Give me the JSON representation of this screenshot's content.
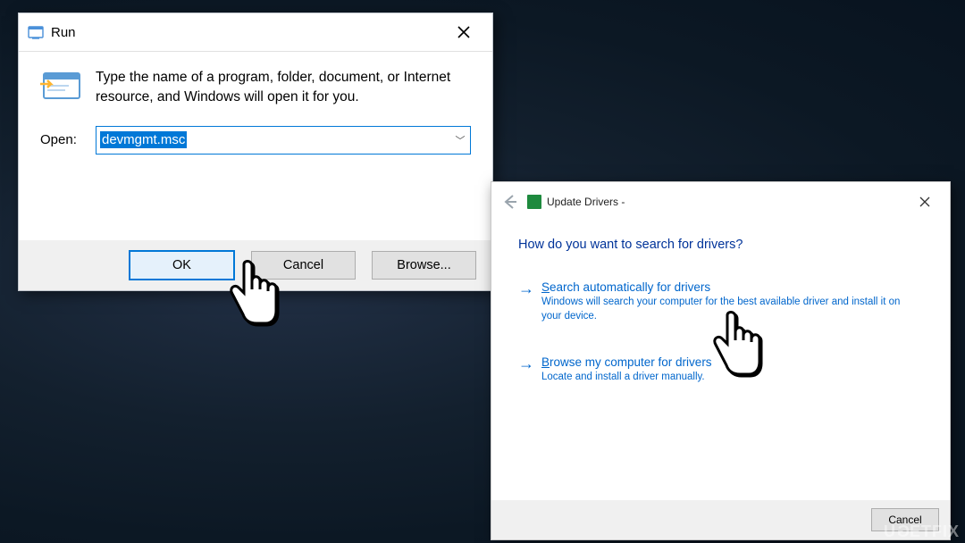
{
  "run": {
    "title": "Run",
    "instruction": "Type the name of a program, folder, document, or Internet resource, and Windows will open it for you.",
    "openLabel": "Open:",
    "value": "devmgmt.msc",
    "buttons": {
      "ok": "OK",
      "cancel": "Cancel",
      "browse": "Browse..."
    }
  },
  "update": {
    "title": "Update Drivers -",
    "question": "How do you want to search for drivers?",
    "opt1": {
      "title_pre": "S",
      "title_rest": "earch automatically for drivers",
      "desc": "Windows will search your computer for the best available driver and install it on your device."
    },
    "opt2": {
      "title_pre": "B",
      "title_rest": "rowse my computer for drivers",
      "desc": "Locate and install a driver manually."
    },
    "cancel": "Cancel"
  },
  "watermark": "UGETFIX"
}
